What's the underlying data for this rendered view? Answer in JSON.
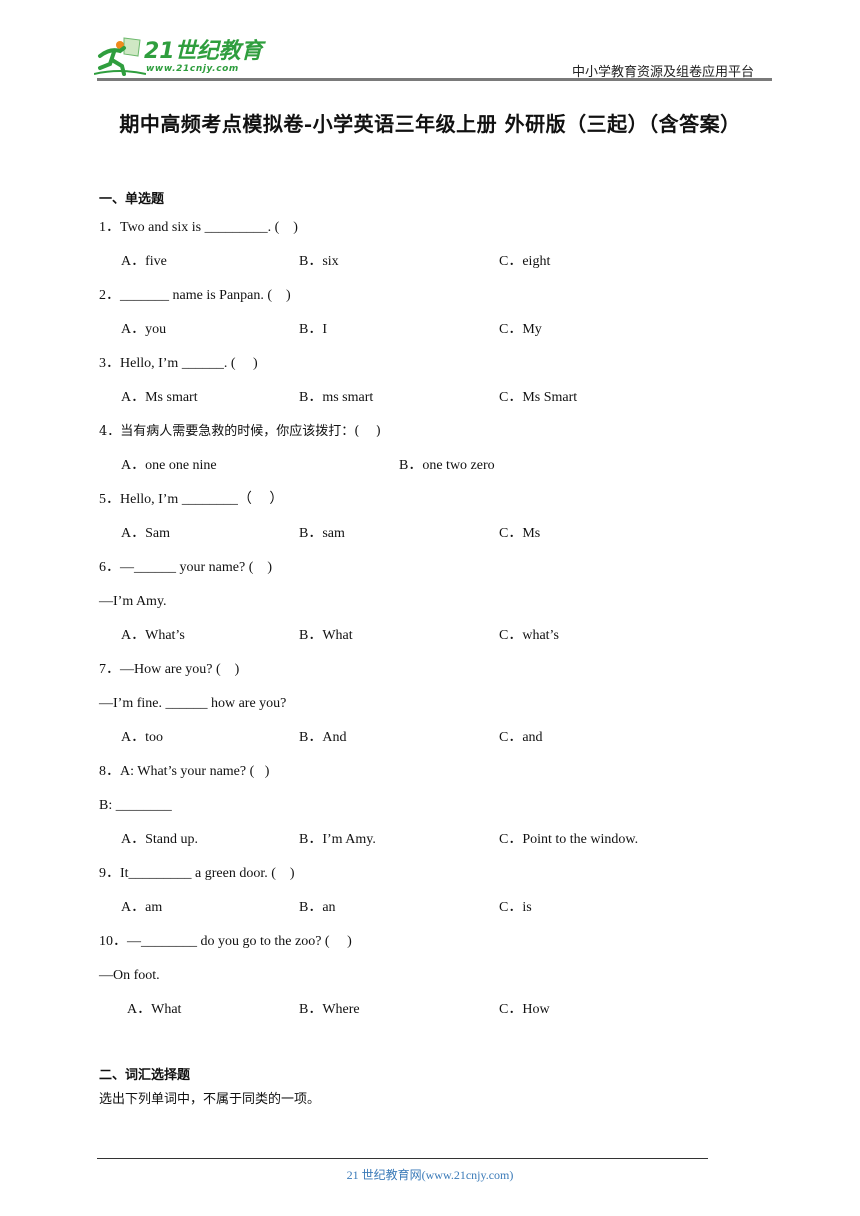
{
  "header": {
    "logo_brand": "21世纪教育",
    "logo_url": "www.21cnjy.com",
    "platform": "中小学教育资源及组卷应用平台",
    "brand_color": "#2f9e3e"
  },
  "title": "期中高频考点模拟卷-小学英语三年级上册 外研版（三起）（含答案）",
  "sections": [
    {
      "title": "一、单选题",
      "questions": [
        {
          "stem": [
            "1．Two and six is _________. (    )"
          ],
          "options": [
            "A．five",
            "B．six",
            "C．eight"
          ]
        },
        {
          "stem": [
            "2．_______ name is Panpan. (    )"
          ],
          "options": [
            "A．you",
            "B．I",
            "C．My"
          ]
        },
        {
          "stem": [
            "3．Hello, I’m ______. (     )"
          ],
          "options": [
            "A．Ms smart",
            "B．ms smart",
            "C．Ms Smart"
          ]
        },
        {
          "stem": [
            "4．当有病人需要急救的时候，你应该拨打：(    )"
          ],
          "options": [
            "A．one one nine",
            "B．one two zero"
          ]
        },
        {
          "stem": [
            "5．Hello, I’m ________（     ）"
          ],
          "options": [
            "A．Sam",
            "B．sam",
            "C．Ms"
          ]
        },
        {
          "stem": [
            "6．—______ your name? (    )",
            "—I’m Amy."
          ],
          "options": [
            "A．What’s",
            "B．What",
            "C．what’s"
          ]
        },
        {
          "stem": [
            "7．—How are you? (    )",
            "—I’m fine. ______ how are you?"
          ],
          "options": [
            "A．too",
            "B．And",
            "C．and"
          ]
        },
        {
          "stem": [
            "8．A: What’s your name? (   )",
            "B: ________"
          ],
          "options": [
            "A．Stand up.",
            "B．I’m Amy.",
            "C．Point to the window."
          ]
        },
        {
          "stem": [
            "9．It_________ a green door. (    )"
          ],
          "options": [
            "A．am",
            "B．an",
            "C．is"
          ]
        },
        {
          "stem": [
            "10．—________ do you go to the zoo? (     )",
            "—On foot."
          ],
          "options": [
            "A．What",
            "B．Where",
            "C．How"
          ]
        }
      ]
    },
    {
      "title": "二、词汇选择题",
      "instruction": "选出下列单词中，不属于同类的一项。"
    }
  ],
  "footer": {
    "text": "21 世纪教育网(www.21cnjy.com)",
    "color": "#3a7ab8"
  }
}
